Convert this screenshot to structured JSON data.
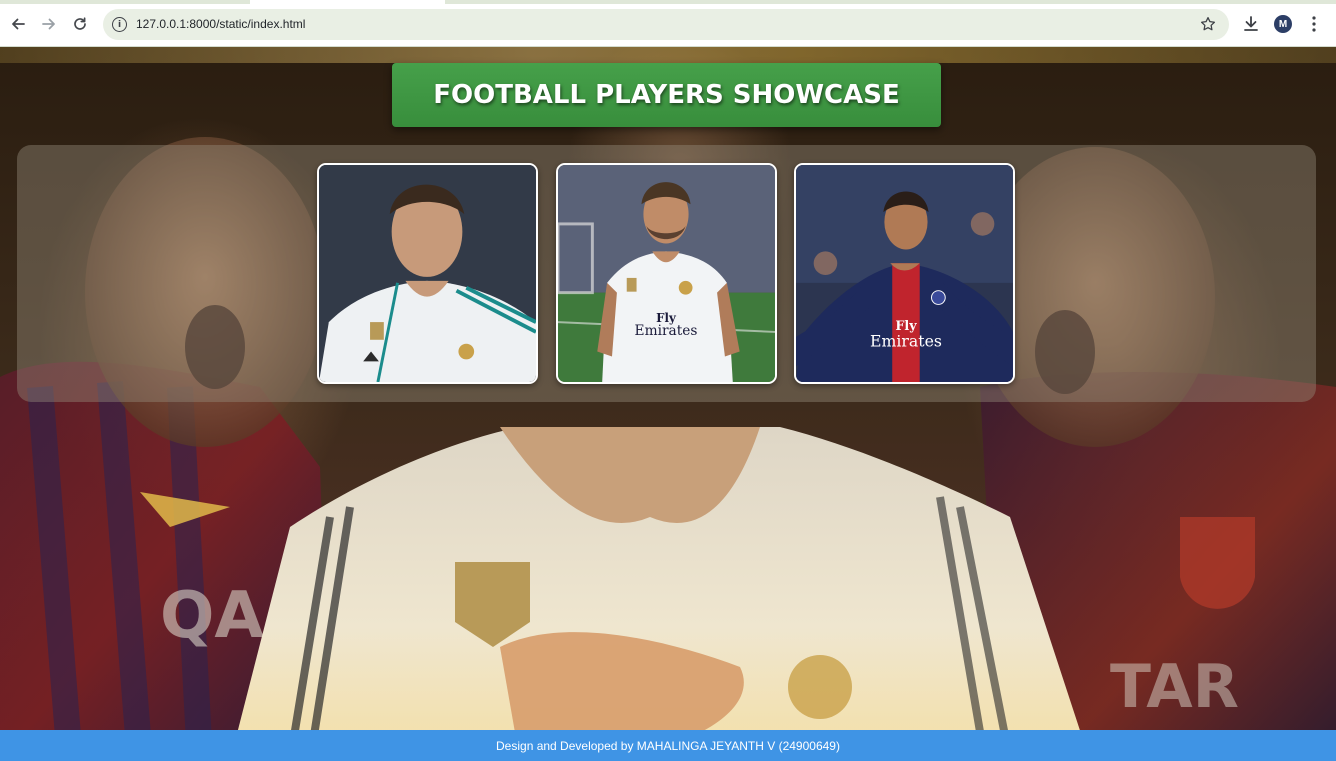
{
  "browser": {
    "url": "127.0.0.1:8000/static/index.html",
    "profile_initial": "M",
    "icons": [
      "back-icon",
      "forward-icon",
      "reload-icon",
      "site-info-icon",
      "star-icon",
      "download-icon",
      "more-menu-icon"
    ]
  },
  "page": {
    "title": "FOOTBALL PLAYERS SHOWCASE",
    "accent_color": "#388e3c",
    "footer_color": "#3f94e5",
    "players": [
      {
        "kit": "Real Madrid white kit",
        "sponsor": ""
      },
      {
        "kit": "Real Madrid white kit",
        "sponsor": "Fly Emirates"
      },
      {
        "kit": "PSG navy kit",
        "sponsor": "Fly Emirates"
      }
    ],
    "footer_text": "Design and Developed by MAHALINGA JEYANTH V (24900649)"
  }
}
